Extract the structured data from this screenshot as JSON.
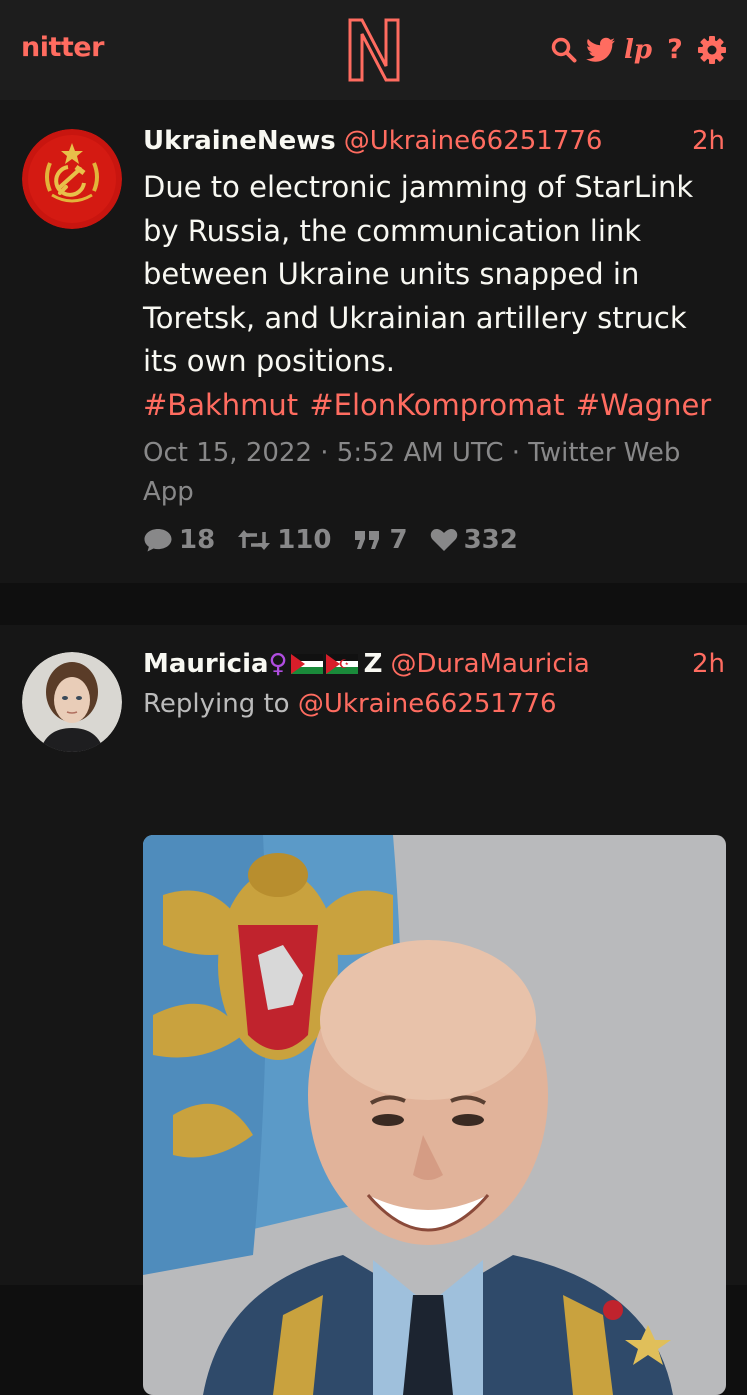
{
  "navbar": {
    "brand": "nitter",
    "icons": [
      "search-icon",
      "twitter-bird-icon",
      "rss-icon",
      "help-icon",
      "gear-icon"
    ],
    "rss_label": "lp",
    "help_label": "?"
  },
  "colors": {
    "accent": "#ff6c60",
    "background": "#0f0f0f",
    "card": "#161616",
    "muted": "#888889"
  },
  "tweets": [
    {
      "fullname": "UkraineNews",
      "username": "@Ukraine66251776",
      "time": "2h",
      "text": "Due to electronic jamming of StarLink by Russia, the communication link between Ukraine units snapped in Toretsk, and Ukrainian artillery struck its own positions.",
      "hashtags": [
        "#Bakhmut",
        "#ElonKompromat",
        "#Wagner"
      ],
      "published": "Oct 15, 2022 · 5:52 AM UTC · Twitter Web App",
      "stats": {
        "comments": "18",
        "retweets": "110",
        "quotes": "7",
        "likes": "332"
      }
    },
    {
      "fullname": "Mauricia",
      "name_suffix": "Z",
      "venus": "♀",
      "username": "@DuraMauricia",
      "time": "2h",
      "replying_label": "Replying to",
      "replying_to": "@Ukraine66251776"
    }
  ]
}
